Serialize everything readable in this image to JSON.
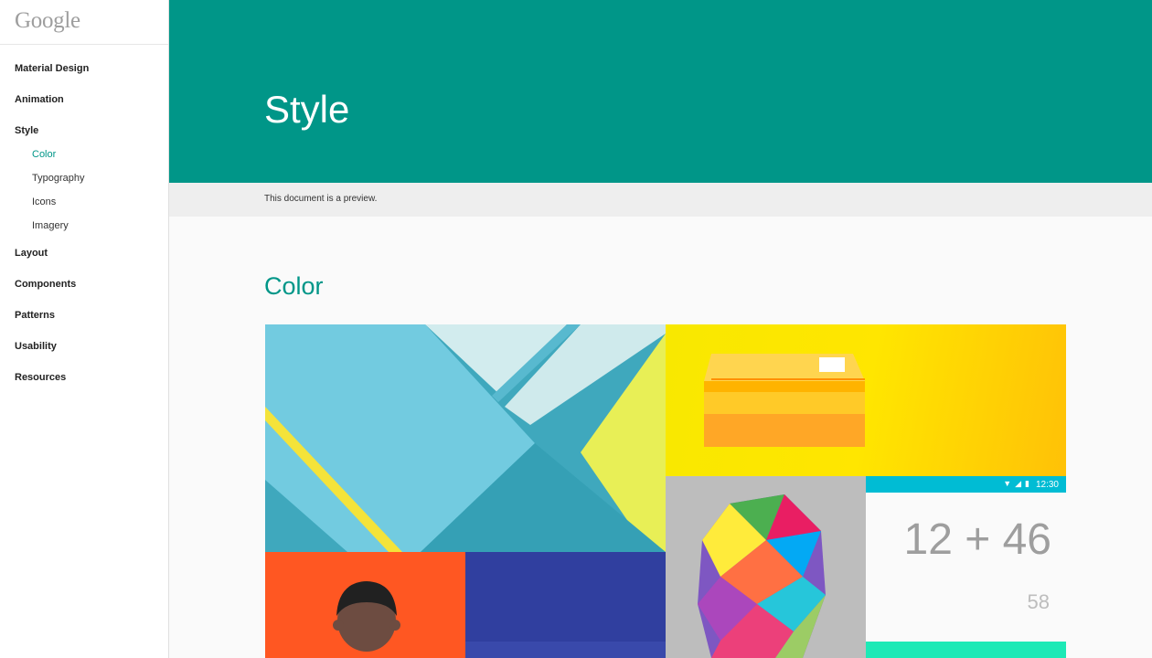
{
  "sidebar": {
    "logo": "Google",
    "items": [
      {
        "label": "Material Design"
      },
      {
        "label": "Animation"
      },
      {
        "label": "Style"
      },
      {
        "label": "Layout"
      },
      {
        "label": "Components"
      },
      {
        "label": "Patterns"
      },
      {
        "label": "Usability"
      },
      {
        "label": "Resources"
      }
    ],
    "style_subitems": [
      {
        "label": "Color",
        "active": true
      },
      {
        "label": "Typography"
      },
      {
        "label": "Icons"
      },
      {
        "label": "Imagery"
      }
    ]
  },
  "header": {
    "title": "Style",
    "background": "#009688"
  },
  "notice": {
    "text": "This document is a preview."
  },
  "section": {
    "title": "Color",
    "accent": "#009688"
  },
  "mosaic": {
    "status_time": "12:30",
    "status_icons": [
      "wifi-icon",
      "signal-icon",
      "battery-icon"
    ],
    "calc_expression": "12 + 46",
    "calc_result": "58",
    "colors": {
      "cyan": "#44b2c7",
      "yellow": "#ffe600",
      "orange": "#ff5722",
      "indigo": "#303f9f",
      "grey": "#bdbdbd",
      "status": "#00bcd4",
      "teal_accent": "#1de9b6"
    }
  }
}
